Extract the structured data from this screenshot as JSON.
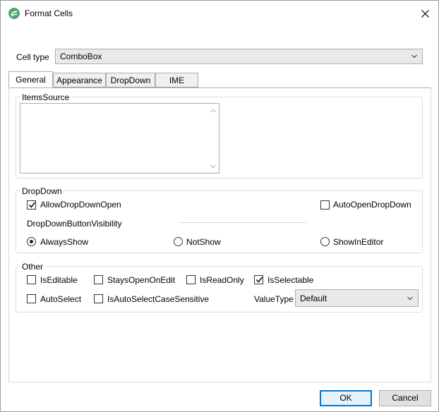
{
  "window": {
    "title": "Format Cells",
    "close_label": "close"
  },
  "cell_type": {
    "label": "Cell type",
    "value": "ComboBox"
  },
  "tabs": [
    {
      "label": "General",
      "active": true
    },
    {
      "label": "Appearance",
      "active": false
    },
    {
      "label": "DropDown",
      "active": false
    },
    {
      "label": "IME",
      "active": false
    }
  ],
  "items_source": {
    "title": "ItemsSource",
    "value": ""
  },
  "dropdown": {
    "title": "DropDown",
    "allow_open": {
      "label": "AllowDropDownOpen",
      "checked": true
    },
    "auto_open": {
      "label": "AutoOpenDropDown",
      "checked": false
    },
    "visibility_label": "DropDownButtonVisibility",
    "options": [
      {
        "label": "AlwaysShow",
        "selected": true
      },
      {
        "label": "NotShow",
        "selected": false
      },
      {
        "label": "ShowInEditor",
        "selected": false
      }
    ]
  },
  "other": {
    "title": "Other",
    "is_editable": {
      "label": "IsEditable",
      "checked": false
    },
    "stays_open": {
      "label": "StaysOpenOnEdit",
      "checked": false
    },
    "is_read_only": {
      "label": "IsReadOnly",
      "checked": false
    },
    "is_selectable": {
      "label": "IsSelectable",
      "checked": true
    },
    "auto_select": {
      "label": "AutoSelect",
      "checked": false
    },
    "case_sensitive": {
      "label": "IsAutoSelectCaseSensitive",
      "checked": false
    },
    "value_type": {
      "label": "ValueType",
      "value": "Default"
    }
  },
  "buttons": {
    "ok": "OK",
    "cancel": "Cancel"
  },
  "colors": {
    "accent": "#0078d7",
    "icon_green": "#3a9a6a"
  }
}
